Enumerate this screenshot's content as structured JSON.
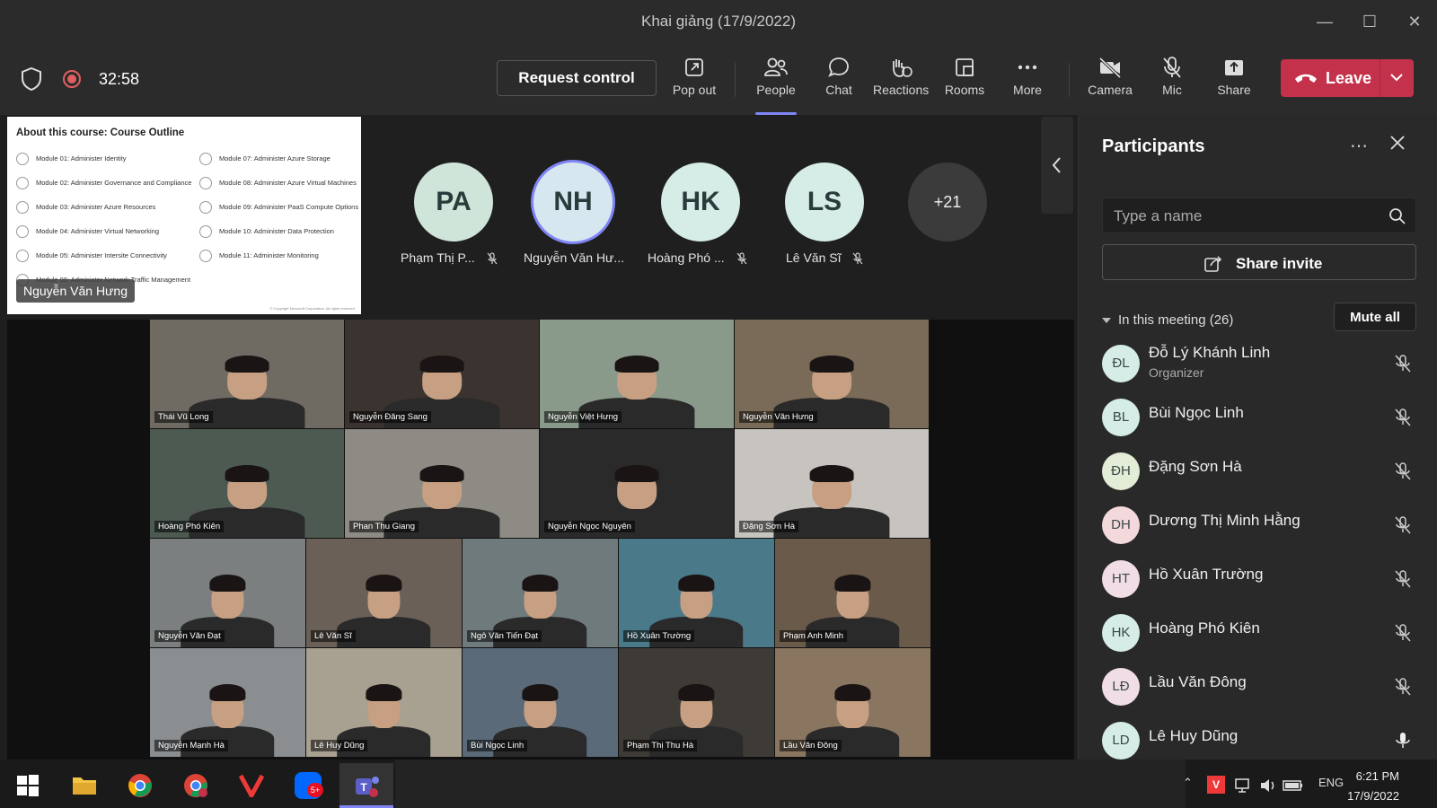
{
  "window": {
    "title": "Khai giảng (17/9/2022)"
  },
  "toolbar": {
    "timer": "32:58",
    "request_control": "Request control",
    "pop_out": "Pop out",
    "people": "People",
    "chat": "Chat",
    "reactions": "Reactions",
    "rooms": "Rooms",
    "more": "More",
    "camera": "Camera",
    "mic": "Mic",
    "share": "Share",
    "leave": "Leave"
  },
  "slide": {
    "title": "About this course: Course Outline",
    "modules_left": [
      "Module 01: Administer Identity",
      "Module 02: Administer Governance and Compliance",
      "Module 03: Administer Azure Resources",
      "Module 04: Administer Virtual Networking",
      "Module 05: Administer Intersite Connectivity",
      "Module 06: Administer Network Traffic Management"
    ],
    "modules_right": [
      "Module 07: Administer Azure Storage",
      "Module 08: Administer Azure Virtual Machines",
      "Module 09: Administer PaaS Compute Options",
      "Module 10: Administer Data Protection",
      "Module 11: Administer Monitoring"
    ],
    "copyright": "© Copyright Microsoft Corporation. All rights reserved.",
    "presenter": "Nguyễn Văn Hưng"
  },
  "stage": {
    "avatars": [
      {
        "initials": "PA",
        "name": "Phạm Thị P...",
        "muted": true
      },
      {
        "initials": "NH",
        "name": "Nguyễn Văn Hư...",
        "muted": false
      },
      {
        "initials": "HK",
        "name": "Hoàng Phó ...",
        "muted": true
      },
      {
        "initials": "LS",
        "name": "Lê Văn Sĩ",
        "muted": true
      }
    ],
    "overflow": "+21"
  },
  "video": {
    "row1": [
      "Thái Vũ Long",
      "Nguyễn Đăng Sang",
      "Nguyễn Việt Hưng",
      "Nguyễn Văn Hưng"
    ],
    "row2": [
      "Hoàng Phó Kiên",
      "Phan Thu Giang",
      "Nguyễn Ngọc Nguyên",
      "Đặng Sơn Hà"
    ],
    "row3": [
      "Nguyễn Văn Đạt",
      "Lê Văn Sĩ",
      "Ngô Văn Tiến Đạt",
      "Hồ Xuân Trường",
      "Phạm Anh Minh"
    ],
    "row4": [
      "Nguyễn Mạnh Hà",
      "Lê Huy Dũng",
      "Bùi Ngọc Linh",
      "Phạm Thị Thu Hà",
      "Lầu Văn Đông"
    ]
  },
  "panel": {
    "title": "Participants",
    "search_placeholder": "Type a name",
    "share_invite": "Share invite",
    "in_meeting": "In this meeting (26)",
    "mute_all": "Mute all",
    "participants": [
      {
        "initials": "ĐL",
        "name": "Đỗ Lý Khánh Linh",
        "role": "Organizer",
        "muted": true
      },
      {
        "initials": "BL",
        "name": "Bùi Ngọc Linh",
        "role": "",
        "muted": true
      },
      {
        "initials": "ĐH",
        "name": "Đặng Sơn Hà",
        "role": "",
        "muted": true
      },
      {
        "initials": "DH",
        "name": "Dương Thị Minh Hằng",
        "role": "",
        "muted": true
      },
      {
        "initials": "HT",
        "name": "Hồ Xuân Trường",
        "role": "",
        "muted": true
      },
      {
        "initials": "HK",
        "name": "Hoàng Phó Kiên",
        "role": "",
        "muted": true
      },
      {
        "initials": "LĐ",
        "name": "Lầu Văn Đông",
        "role": "",
        "muted": true
      },
      {
        "initials": "LD",
        "name": "Lê Huy Dũng",
        "role": "",
        "muted": false
      }
    ]
  },
  "taskbar": {
    "zalo_badge": "5+",
    "lang": "ENG",
    "time": "6:21 PM",
    "date": "17/9/2022"
  },
  "colors": {
    "accent": "#7f85f5",
    "leave": "#c4314b",
    "avatar_bg": "#d7ece6"
  }
}
